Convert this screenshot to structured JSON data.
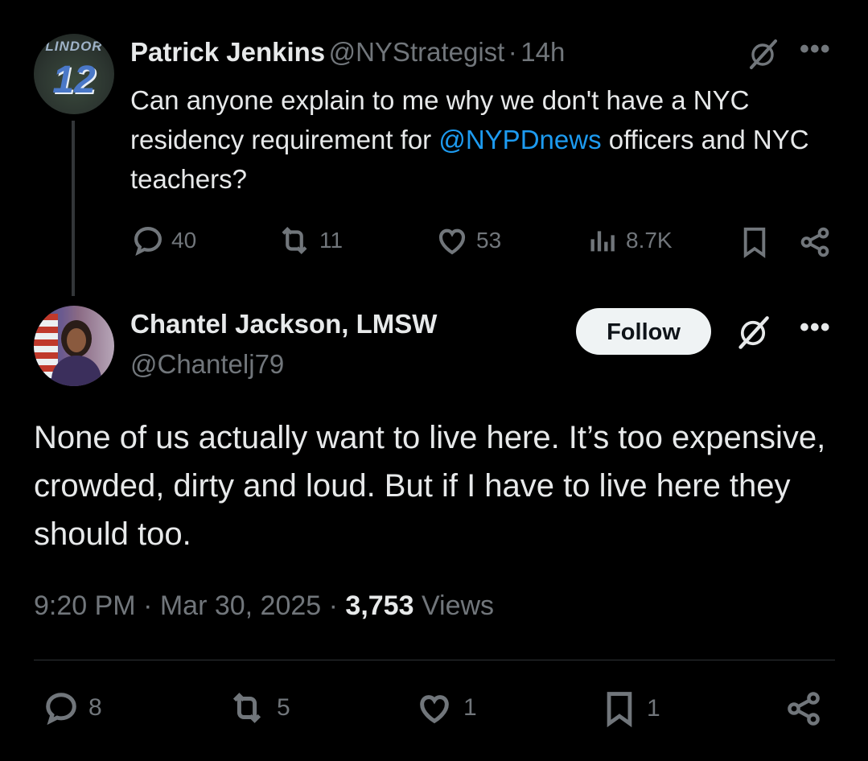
{
  "parent_tweet": {
    "author_name": "Patrick Jenkins",
    "handle": "@NYStrategist",
    "separator": "·",
    "time": "14h",
    "jersey_name": "LINDOR",
    "jersey_number": "12",
    "text_before": "Can anyone explain to me why we don't have a NYC residency requirement for ",
    "mention": "@NYPDnews",
    "text_after": " officers and NYC teachers?",
    "stats": {
      "replies": "40",
      "reposts": "11",
      "likes": "53",
      "views": "8.7K"
    }
  },
  "reply_tweet": {
    "author_name": "Chantel Jackson, LMSW",
    "handle": "@Chantelj79",
    "follow_label": "Follow",
    "text": "None of us actually want to live here. It’s too expensive, crowded, dirty and loud. But if I have to live here they should too.",
    "timestamp": "9:20 PM · Mar 30, 2025 · ",
    "views_count": "3,753",
    "views_label": " Views",
    "stats": {
      "replies": "8",
      "reposts": "5",
      "likes": "1",
      "bookmarks": "1"
    }
  },
  "colors": {
    "background": "#000000",
    "text": "#e7e9ea",
    "secondary": "#71767b",
    "mention": "#1d9bf0"
  }
}
